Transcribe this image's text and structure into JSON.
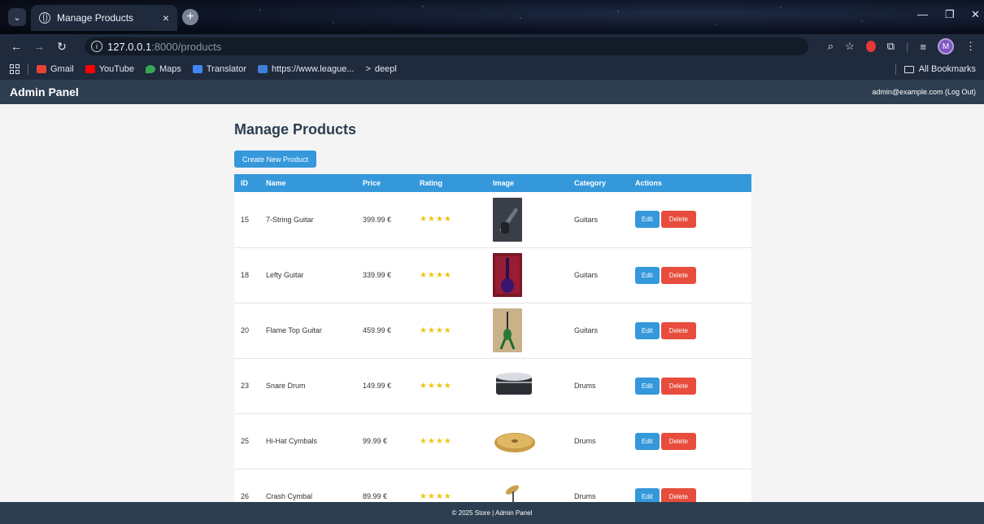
{
  "browser": {
    "tab_title": "Manage Products",
    "tab_close": "×",
    "new_tab": "+",
    "url_host": "127.0.0.1",
    "url_path": ":8000/products",
    "bookmarks": [
      {
        "label": "Gmail",
        "color": "#ea4335"
      },
      {
        "label": "YouTube",
        "color": "#ff0000"
      },
      {
        "label": "Maps",
        "color": "#34a853"
      },
      {
        "label": "Translator",
        "color": "#4285f4"
      },
      {
        "label": "https://www.league...",
        "color": "#3f7fd8"
      },
      {
        "label": "deepl",
        "color": "#d8dee8"
      }
    ],
    "all_bookmarks": "All Bookmarks",
    "avatar_letter": "M"
  },
  "header": {
    "brand": "Admin Panel",
    "user": "admin@example.com (Log Out)"
  },
  "page": {
    "title": "Manage Products",
    "create_label": "Create New Product"
  },
  "table": {
    "columns": [
      "ID",
      "Name",
      "Price",
      "Rating",
      "Image",
      "Category",
      "Actions"
    ],
    "rows": [
      {
        "id": "15",
        "name": "7-String Guitar",
        "price": "399.99 €",
        "rating": 4,
        "category": "Guitars"
      },
      {
        "id": "18",
        "name": "Lefty Guitar",
        "price": "339.99 €",
        "rating": 4,
        "category": "Guitars"
      },
      {
        "id": "20",
        "name": "Flame Top Guitar",
        "price": "459.99 €",
        "rating": 4,
        "category": "Guitars"
      },
      {
        "id": "23",
        "name": "Snare Drum",
        "price": "149.99 €",
        "rating": 4,
        "category": "Drums"
      },
      {
        "id": "25",
        "name": "Hi-Hat Cymbals",
        "price": "99.99 €",
        "rating": 4,
        "category": "Drums"
      },
      {
        "id": "26",
        "name": "Crash Cymbal",
        "price": "89.99 €",
        "rating": 4,
        "category": "Drums"
      }
    ],
    "edit_label": "Edit",
    "delete_label": "Delete"
  },
  "footer": {
    "text": "© 2025 Store | Admin Panel"
  },
  "colors": {
    "header_bg": "#2c3e50",
    "accent": "#3498db",
    "danger": "#e74c3c",
    "star": "#f1c40f"
  },
  "icons": {
    "tab_favicon": "globe-icon",
    "info": "info-icon",
    "zoom": "zoom-icon",
    "star": "bookmark-star-icon",
    "star_rating": "star-icon"
  }
}
